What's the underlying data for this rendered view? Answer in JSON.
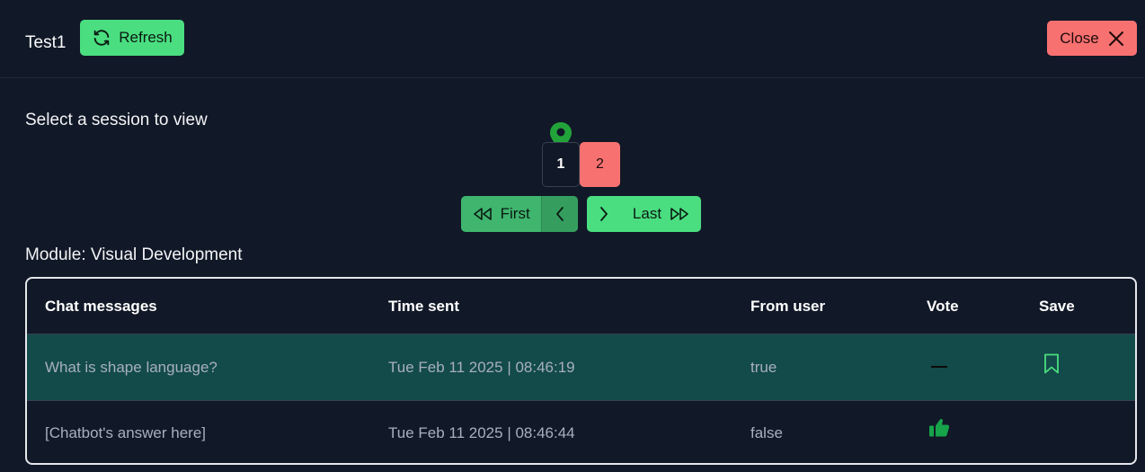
{
  "header": {
    "title": "Test1",
    "refresh_label": "Refresh",
    "close_label": "Close"
  },
  "session": {
    "prompt": "Select a session to view",
    "pages": [
      "1",
      "2"
    ],
    "current_page": "1",
    "nav": {
      "first_label": "First",
      "last_label": "Last"
    }
  },
  "module": {
    "label": "Module: Visual Development"
  },
  "table": {
    "columns": [
      "Chat messages",
      "Time sent",
      "From user",
      "Vote",
      "Save"
    ],
    "rows": [
      {
        "message": "What is shape language?",
        "time": "Tue Feb 11 2025 | 08:46:19",
        "from_user": "true",
        "vote": "dash-icon",
        "save": "bookmark-icon"
      },
      {
        "message": "[Chatbot's answer here]",
        "time": "Tue Feb 11 2025 | 08:46:44",
        "from_user": "false",
        "vote": "thumbs-up-icon",
        "save": ""
      }
    ]
  },
  "colors": {
    "background": "#111827",
    "accent_green": "#4ade80",
    "accent_red": "#f87171",
    "selected_row": "#134a4a"
  }
}
